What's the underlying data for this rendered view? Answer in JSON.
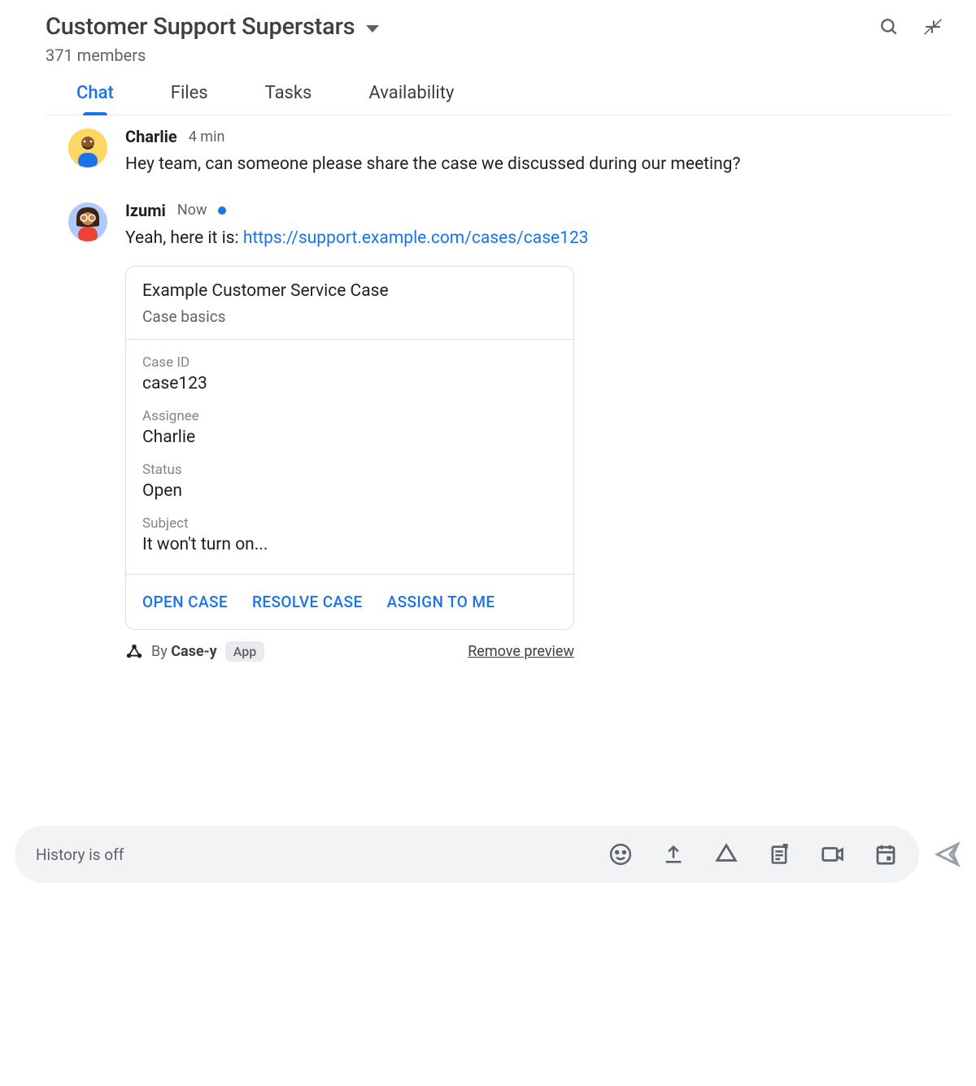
{
  "header": {
    "title": "Customer Support Superstars",
    "members": "371 members"
  },
  "tabs": [
    {
      "label": "Chat",
      "active": true
    },
    {
      "label": "Files",
      "active": false
    },
    {
      "label": "Tasks",
      "active": false
    },
    {
      "label": "Availability",
      "active": false
    }
  ],
  "messages": [
    {
      "author": "Charlie",
      "time": "4 min",
      "new": false,
      "text_plain": "Hey team, can someone please share the case we discussed during our meeting?"
    },
    {
      "author": "Izumi",
      "time": "Now",
      "new": true,
      "text_prefix": "Yeah, here it is: ",
      "link_text": "https://support.example.com/cases/case123"
    }
  ],
  "card": {
    "title": "Example Customer Service Case",
    "subtitle": "Case basics",
    "fields": [
      {
        "label": "Case ID",
        "value": "case123"
      },
      {
        "label": "Assignee",
        "value": "Charlie"
      },
      {
        "label": "Status",
        "value": "Open"
      },
      {
        "label": "Subject",
        "value": "It won't turn on..."
      }
    ],
    "actions": [
      {
        "label": "OPEN CASE"
      },
      {
        "label": "RESOLVE CASE"
      },
      {
        "label": "ASSIGN TO ME"
      }
    ],
    "footer_by": "By ",
    "footer_app_name": "Case-y",
    "footer_badge": "App",
    "remove_preview": "Remove preview"
  },
  "composer": {
    "placeholder": "History is off"
  }
}
